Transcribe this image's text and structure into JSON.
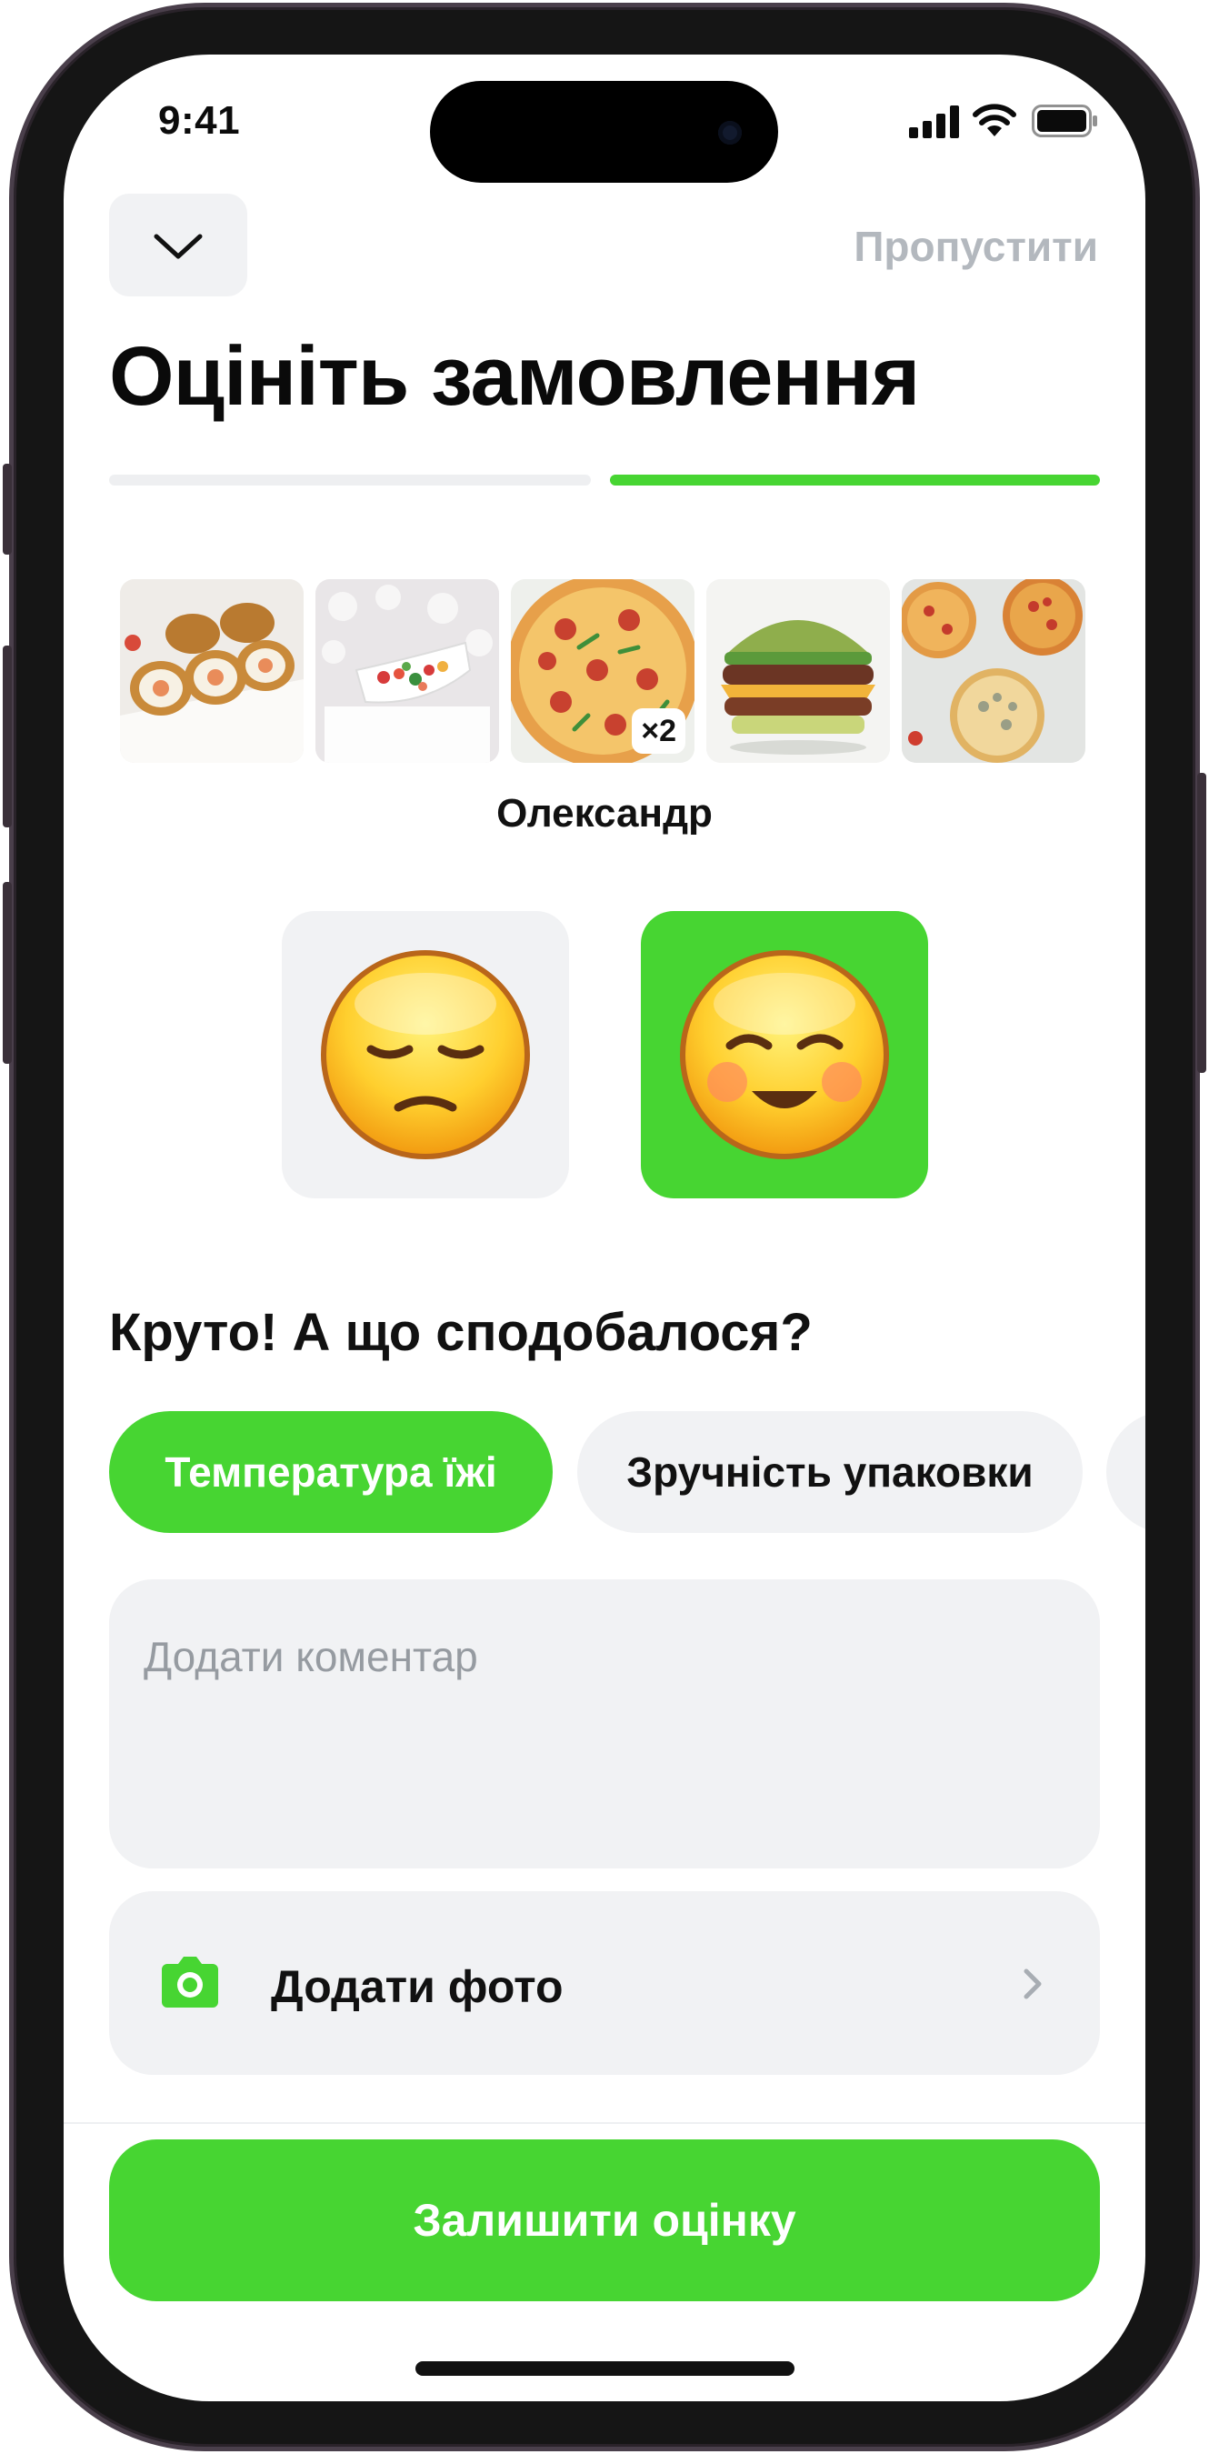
{
  "status_bar": {
    "time": "9:41"
  },
  "header": {
    "skip_label": "Пропустити",
    "title": "Оцініть замовлення"
  },
  "progress": {
    "steps": 2,
    "current_step": 2
  },
  "order": {
    "items": [
      {
        "name": "sushi-rolls"
      },
      {
        "name": "salad"
      },
      {
        "name": "pizza",
        "quantity_badge": "×2"
      },
      {
        "name": "burger"
      },
      {
        "name": "pizza-set"
      }
    ],
    "courier_name": "Олександр"
  },
  "rating": {
    "options": [
      {
        "icon": "unamused-face-icon",
        "selected": false
      },
      {
        "icon": "smiling-face-icon",
        "selected": true
      }
    ]
  },
  "feedback": {
    "question": "Круто! А що сподобалося?",
    "chips": [
      {
        "label": "Температура їжі",
        "selected": true
      },
      {
        "label": "Зручність упаковки",
        "selected": false
      },
      {
        "label": "",
        "selected": false
      }
    ],
    "comment_placeholder": "Додати коментар",
    "photo_label": "Додати фото"
  },
  "submit_label": "Залишити оцінку",
  "colors": {
    "accent": "#47d532",
    "surface": "#f1f2f4",
    "muted_text": "#b3b8be"
  }
}
